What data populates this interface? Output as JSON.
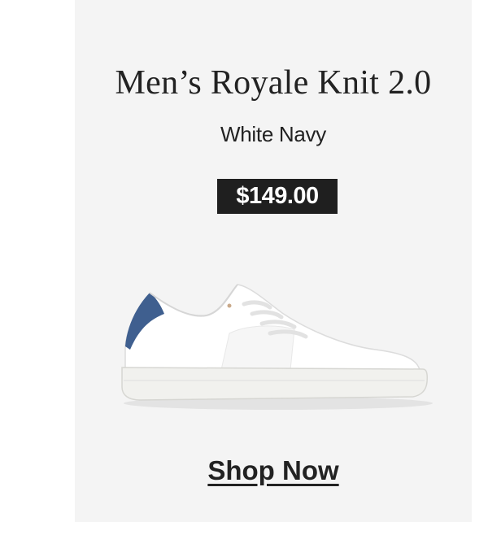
{
  "product": {
    "title": "Men’s Royale Knit 2.0",
    "color_name": "White Navy",
    "price": "$149.00",
    "image_icon": "sneaker-image"
  },
  "cta": {
    "label": "Shop Now"
  },
  "colors": {
    "card_background": "#f4f4f4",
    "price_badge": "#1f1f1f",
    "heel_accent": "#3f5f8f"
  }
}
